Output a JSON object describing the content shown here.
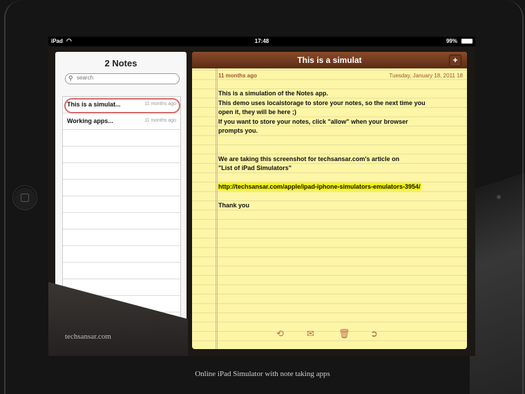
{
  "status_bar": {
    "device": "iPad",
    "time": "17:48",
    "battery": "99%"
  },
  "sidebar": {
    "title": "2 Notes",
    "search_placeholder": "search",
    "items": [
      {
        "title": "This is a simulat...",
        "date": "11 months ago"
      },
      {
        "title": "Working apps...",
        "date": "11 months ago"
      }
    ]
  },
  "note": {
    "title": "This is a simulat",
    "add_label": "+",
    "relative_date": "11 months ago",
    "date": "Tuesday, January 18, 2011 18",
    "lines": [
      "This is a simulation of the Notes app.",
      "This demo uses localstorage to store your notes, so the next time you",
      "open it, they will be here ;)",
      "If you want to store your notes, click \"allow\" when your browser",
      "prompts you.",
      "",
      "",
      "We are taking this screenshot for techsansar.com's article on",
      "\"List of iPad Simulators\"",
      "",
      "http://techsansar.com/apple/ipad-iphone-simulators-emulators-3954/",
      "",
      "Thank you"
    ],
    "highlight_color": "#f5f500"
  },
  "toolbar": {
    "icons": [
      "back-arrow-icon",
      "mail-icon",
      "trash-icon",
      "forward-arrow-icon"
    ],
    "glyphs": [
      "⟲",
      "✉",
      "🗑",
      "➲"
    ]
  },
  "watermark": "techsansar.com",
  "caption": "Online iPad Simulator with note taking apps",
  "colors": {
    "header_brown": "#6e3a20",
    "paper": "#fcf6a6",
    "date_text": "#a0553a",
    "selection_oval": "#d46a6a"
  }
}
